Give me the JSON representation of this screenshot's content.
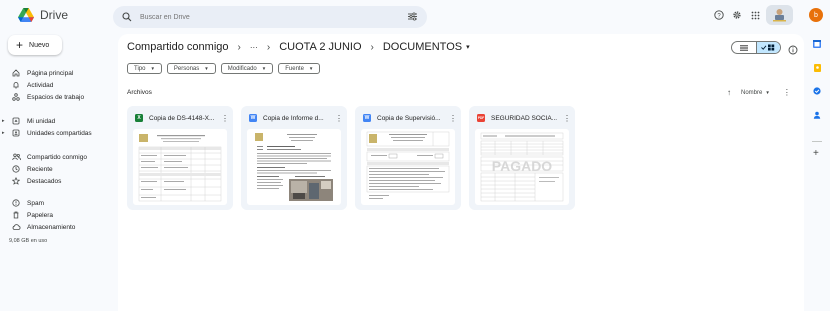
{
  "app": {
    "name": "Drive"
  },
  "search": {
    "placeholder": "Buscar en Drive"
  },
  "top_icons": [
    "help-icon",
    "settings-icon",
    "apps-grid-icon"
  ],
  "avatar": {
    "letter": "b",
    "color": "#e8710a"
  },
  "sidebar": {
    "new_label": "Nuevo",
    "items": [
      {
        "label": "Página principal",
        "icon": "home-icon"
      },
      {
        "label": "Actividad",
        "icon": "bell-icon"
      },
      {
        "label": "Espacios de trabajo",
        "icon": "workspaces-icon"
      },
      {
        "label": "Mi unidad",
        "icon": "my-drive-icon"
      },
      {
        "label": "Unidades compartidas",
        "icon": "shared-drives-icon"
      },
      {
        "label": "Compartido conmigo",
        "icon": "people-icon"
      },
      {
        "label": "Reciente",
        "icon": "clock-icon"
      },
      {
        "label": "Destacados",
        "icon": "star-icon"
      },
      {
        "label": "Spam",
        "icon": "spam-icon"
      },
      {
        "label": "Papelera",
        "icon": "trash-icon"
      },
      {
        "label": "Almacenamiento",
        "icon": "cloud-icon"
      }
    ],
    "storage_used": "9,08 GB en uso"
  },
  "breadcrumb": {
    "root": "Compartido conmigo",
    "ellipsis": "···",
    "parent": "CUOTA 2 JUNIO",
    "current": "DOCUMENTOS"
  },
  "filters": [
    "Tipo",
    "Personas",
    "Modificado",
    "Fuente"
  ],
  "section": {
    "title": "Archivos",
    "sort_label": "Nombre"
  },
  "files": [
    {
      "title": "Copia de DS-4148-X...",
      "type": "sheet",
      "type_letter": "X",
      "color": "#188038"
    },
    {
      "title": "Copia de Informe d...",
      "type": "doc",
      "type_letter": "W",
      "color": "#4285f4"
    },
    {
      "title": "Copia de Supervisió...",
      "type": "doc",
      "type_letter": "W",
      "color": "#4285f4"
    },
    {
      "title": "SEGURIDAD SOCIA...",
      "type": "pdf",
      "type_letter": "PDF",
      "color": "#ea4335"
    }
  ],
  "colors": {
    "accent": "#c2e7ff",
    "background": "#f8fafd",
    "card": "#f0f4f9"
  }
}
